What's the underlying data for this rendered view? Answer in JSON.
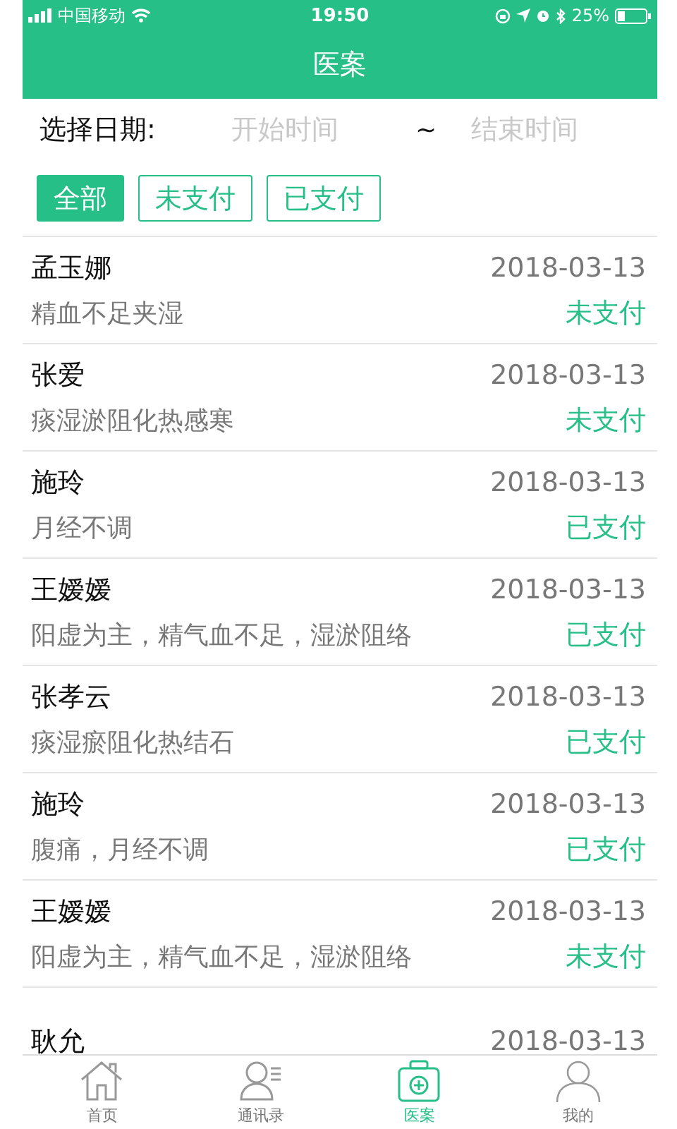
{
  "status_bar": {
    "carrier": "中国移动",
    "time": "19:50",
    "battery": "25%"
  },
  "nav": {
    "title": "医案"
  },
  "date_filter": {
    "label": "选择日期:",
    "start_placeholder": "开始时间",
    "separator": "~",
    "end_placeholder": "结束时间"
  },
  "filters": [
    {
      "label": "全部",
      "selected": true
    },
    {
      "label": "未支付",
      "selected": false
    },
    {
      "label": "已支付",
      "selected": false
    }
  ],
  "records": [
    {
      "name": "孟玉娜",
      "date": "2018-03-13",
      "diagnosis": "精血不足夹湿",
      "status": "未支付"
    },
    {
      "name": "张爱",
      "date": "2018-03-13",
      "diagnosis": "痰湿淤阻化热感寒",
      "status": "未支付"
    },
    {
      "name": "施玲",
      "date": "2018-03-13",
      "diagnosis": "月经不调",
      "status": "已支付"
    },
    {
      "name": "王嫒嫒",
      "date": "2018-03-13",
      "diagnosis": "阳虚为主，精气血不足，湿淤阻络",
      "status": "已支付"
    },
    {
      "name": "张孝云",
      "date": "2018-03-13",
      "diagnosis": "痰湿瘀阻化热结石",
      "status": "已支付"
    },
    {
      "name": "施玲",
      "date": "2018-03-13",
      "diagnosis": "腹痛，月经不调",
      "status": "已支付"
    },
    {
      "name": "王嫒嫒",
      "date": "2018-03-13",
      "diagnosis": "阳虚为主，精气血不足，湿淤阻络",
      "status": "未支付"
    },
    {
      "name": "耿允",
      "date": "2018-03-13"
    }
  ],
  "tab_bar": [
    {
      "label": "首页",
      "kind": "home",
      "selected": false
    },
    {
      "label": "通讯录",
      "kind": "contacts",
      "selected": false
    },
    {
      "label": "医案",
      "kind": "records",
      "selected": true
    },
    {
      "label": "我的",
      "kind": "profile",
      "selected": false
    }
  ]
}
